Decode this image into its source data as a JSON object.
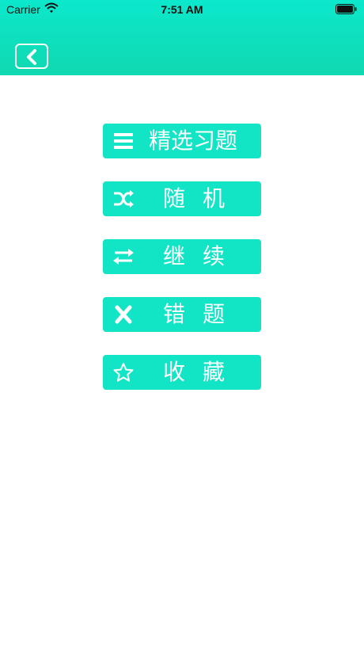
{
  "status_bar": {
    "carrier": "Carrier",
    "time": "7:51 AM"
  },
  "nav": {
    "back_icon": "chevron-left-icon"
  },
  "menu": {
    "items": [
      {
        "label": "精选习题",
        "icon": "list-icon"
      },
      {
        "label": "随机",
        "icon": "shuffle-icon"
      },
      {
        "label": "继续",
        "icon": "repeat-arrows-icon"
      },
      {
        "label": "错题",
        "icon": "close-x-icon"
      },
      {
        "label": "收藏",
        "icon": "star-icon"
      }
    ]
  },
  "colors": {
    "header_top": "#0ce8cc",
    "header_bottom": "#10d8b0",
    "button": "#12e4c6",
    "text": "#ffffff"
  }
}
